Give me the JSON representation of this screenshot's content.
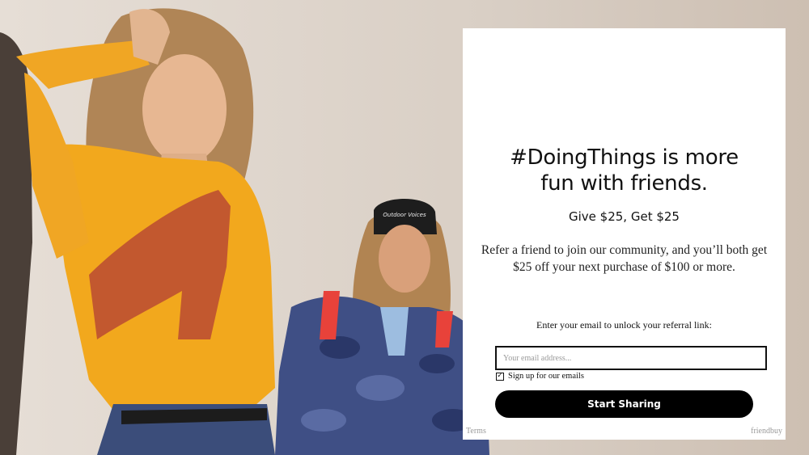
{
  "modal": {
    "headline_line1": "#DoingThings is more",
    "headline_line2": "fun with friends.",
    "offer": "Give $25, Get $25",
    "description": "Refer a friend to join our community, and you’ll both get $25 off your next purchase of $100 or more.",
    "email_prompt": "Enter your email to unlock your referral link:",
    "email_placeholder": "Your email address...",
    "email_value": "",
    "signup_checkbox_label": "Sign up for our emails",
    "signup_checked": true,
    "cta_label": "Start Sharing",
    "terms_link": "Terms",
    "powered_by": "friendbuy"
  },
  "background_photo": {
    "cap_text": "Outdoor Voices",
    "colors": {
      "backdrop": "#d6ccc2",
      "yellow_top": "#f2a81d",
      "rust_sweater": "#c2582f",
      "camo_jacket": "#3f4f85",
      "backpack_strap": "#e8423a"
    }
  }
}
